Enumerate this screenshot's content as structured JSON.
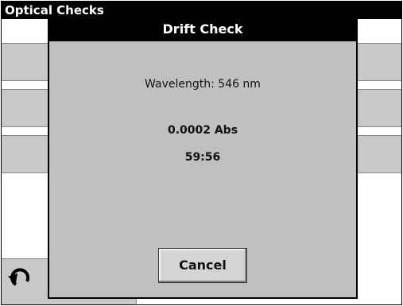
{
  "background": {
    "title": "Optical Checks",
    "back_icon": "back-arrow-icon"
  },
  "dialog": {
    "title": "Drift Check",
    "wavelength": "Wavelength: 546 nm",
    "absorbance": "0.0002 Abs",
    "timer": "59:56",
    "cancel_label": "Cancel"
  }
}
